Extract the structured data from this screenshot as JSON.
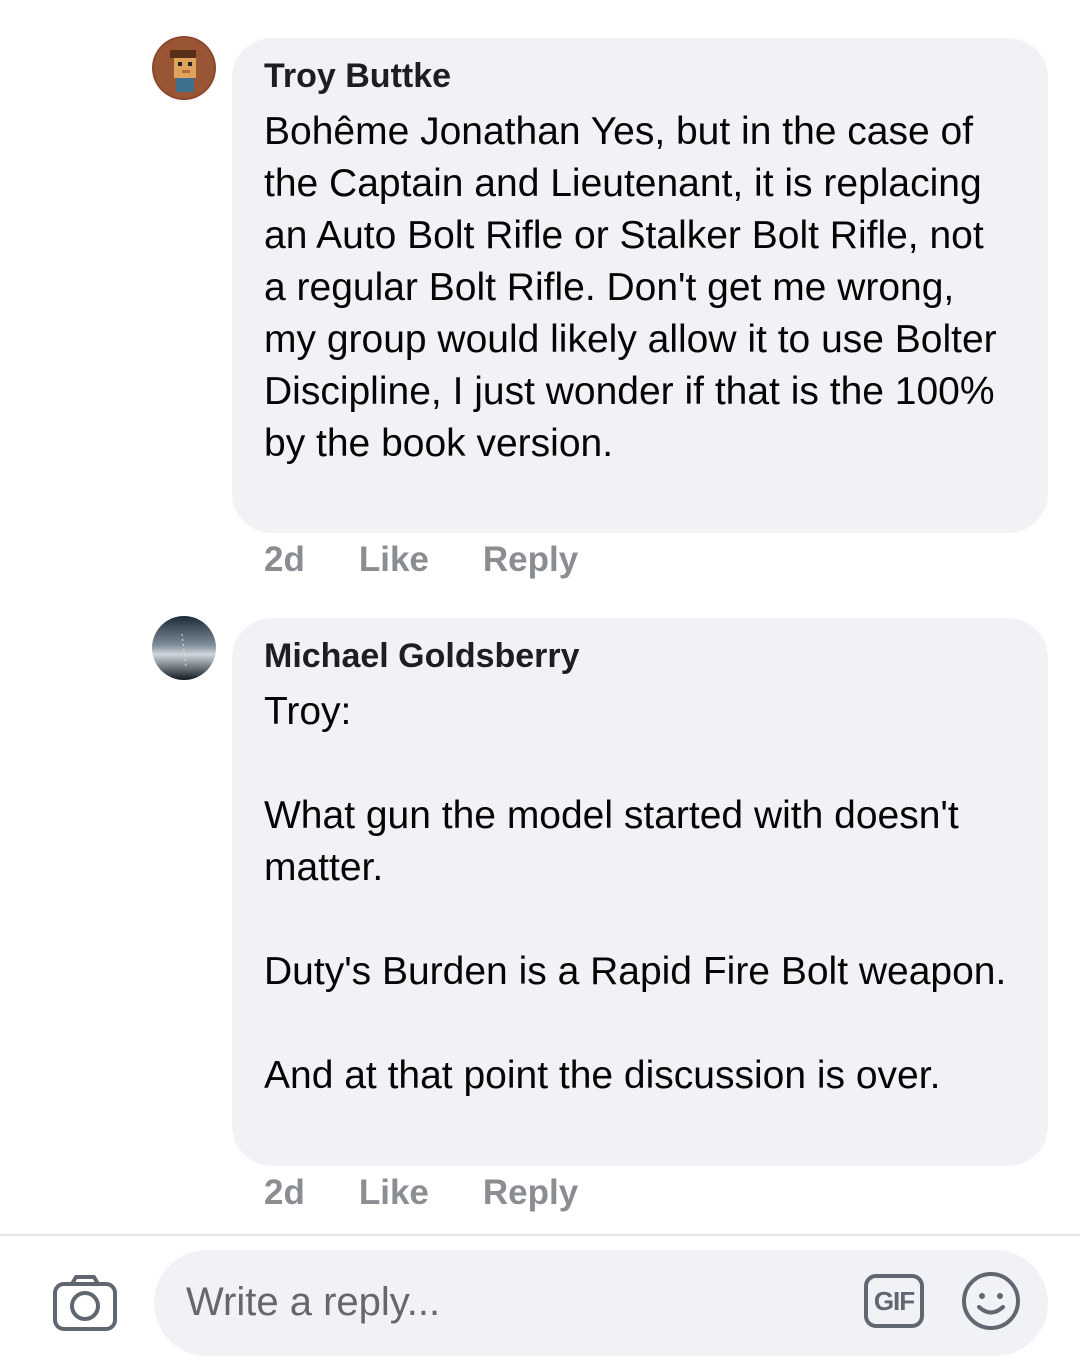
{
  "comments": [
    {
      "author": "Troy Buttke",
      "text": "Bohême Jonathan Yes, but in the case of the Captain and Lieutenant, it is replacing an Auto Bolt Rifle or Stalker Bolt Rifle, not a regular Bolt Rifle. Don't get me wrong, my group would likely allow it to use Bolter Discipline, I just wonder if that is the 100% by the book version.",
      "time": "2d",
      "like_label": "Like",
      "reply_label": "Reply"
    },
    {
      "author": "Michael Goldsberry",
      "text": "Troy:\n\nWhat gun the model started with doesn't matter.\n\nDuty's Burden is a Rapid Fire Bolt weapon.\n\nAnd at that point the discussion is over.",
      "time": "2d",
      "like_label": "Like",
      "reply_label": "Reply"
    }
  ],
  "composer": {
    "placeholder": "Write a reply...",
    "gif_label": "GIF",
    "icons": [
      "camera-icon",
      "gif-icon",
      "emoji-icon"
    ]
  },
  "colors": {
    "bubble": "#f0f2f5",
    "meta": "#8a8d91",
    "text": "#050505"
  }
}
